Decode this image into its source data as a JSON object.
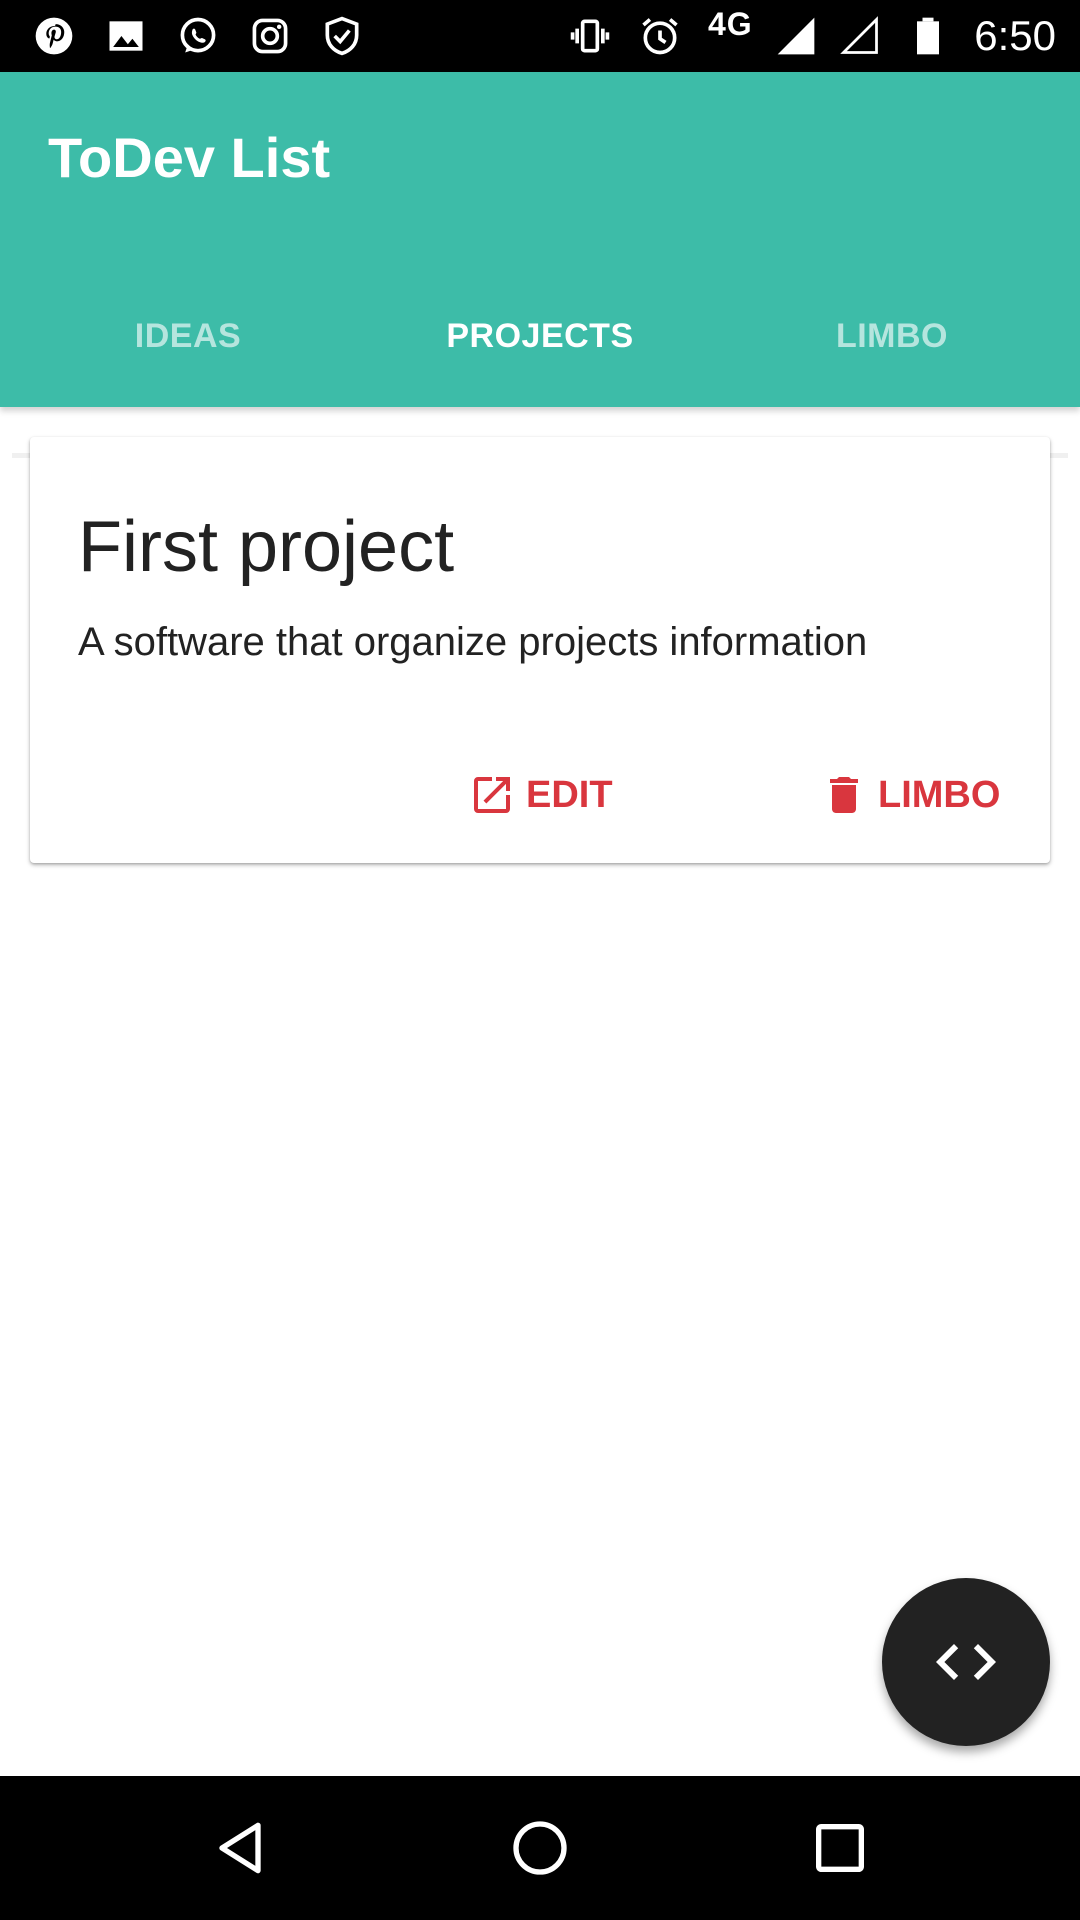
{
  "status_bar": {
    "network": "4G",
    "time": "6:50",
    "icons": [
      "pinterest-icon",
      "gallery-icon",
      "whatsapp-icon",
      "instagram-icon",
      "shield-check-icon",
      "vibrate-icon",
      "alarm-icon",
      "signal-icon",
      "signal-empty-icon",
      "battery-icon"
    ]
  },
  "app_bar": {
    "title": "ToDev List",
    "color": "#3dbca8"
  },
  "tabs": [
    {
      "label": "IDEAS",
      "active": false
    },
    {
      "label": "PROJECTS",
      "active": true
    },
    {
      "label": "LIMBO",
      "active": false
    }
  ],
  "cards": [
    {
      "title": "First project",
      "description": "A software that organize projects information",
      "actions": [
        {
          "label": "EDIT",
          "icon": "open-in-new-icon"
        },
        {
          "label": "LIMBO",
          "icon": "trash-icon"
        }
      ]
    }
  ],
  "accent_color": "#d9363e",
  "fab": {
    "icon": "code-icon",
    "color": "#222222"
  },
  "nav_bar": {
    "icons": [
      "back-triangle-icon",
      "home-circle-icon",
      "recents-square-icon"
    ]
  }
}
